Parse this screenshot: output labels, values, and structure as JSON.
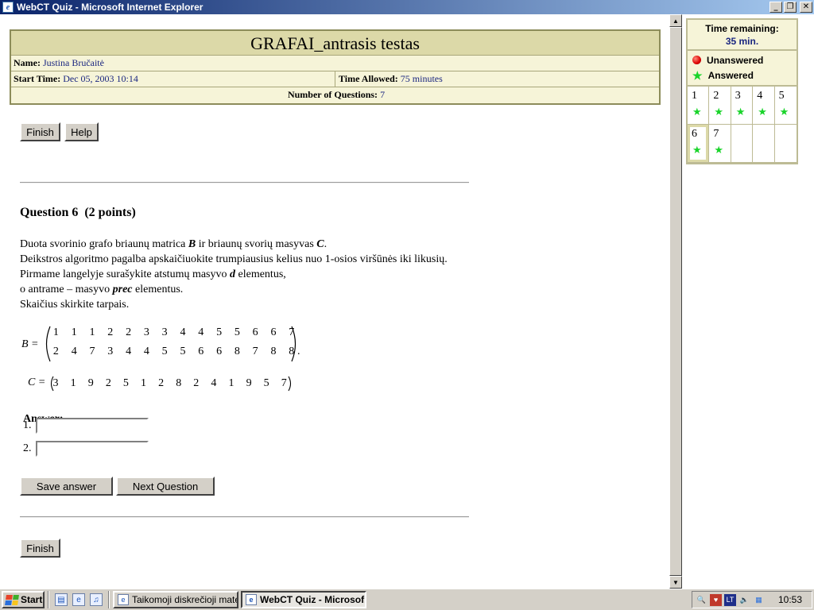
{
  "window": {
    "title": "WebCT Quiz - Microsoft Internet Explorer"
  },
  "quiz": {
    "title": "GRAFAI_antrasis testas",
    "name_label": "Name:",
    "name_value": "Justina Bručaitė",
    "start_label": "Start Time:",
    "start_value": "Dec 05, 2003 10:14",
    "allowed_label": "Time Allowed:",
    "allowed_value": "75 minutes",
    "count_label": "Number of Questions:",
    "count_value": "7"
  },
  "buttons": {
    "finish": "Finish",
    "help": "Help",
    "save_answer": "Save answer",
    "next_question": "Next Question"
  },
  "question": {
    "title": "Question 6  (2 points)",
    "lines": [
      [
        "Duota svorinio grafo briaunų matrica ",
        "B",
        " ir briaunų svorių masyvas ",
        "C",
        "."
      ],
      [
        "Deikstros algoritmo pagalba apskaičiuokite trumpiausius kelius nuo 1-osios viršūnės iki likusių."
      ],
      [
        "Pirmame langelyje surašykite atstumų masyvo ",
        "d",
        " elementus,"
      ],
      [
        "o antrame – masyvo ",
        "prec",
        " elementus."
      ],
      [
        "Skaičius skirkite tarpais."
      ]
    ],
    "matrix_B_name": "B =",
    "matrix_B_row1": [
      "1",
      "1",
      "1",
      "2",
      "2",
      "3",
      "3",
      "4",
      "4",
      "5",
      "5",
      "6",
      "6",
      "7"
    ],
    "matrix_B_row2": [
      "2",
      "4",
      "7",
      "3",
      "4",
      "4",
      "5",
      "5",
      "6",
      "6",
      "8",
      "7",
      "8",
      "8"
    ],
    "matrix_C_name": "C =",
    "matrix_C_row": [
      "3",
      "1",
      "9",
      "2",
      "5",
      "1",
      "2",
      "8",
      "2",
      "4",
      "1",
      "9",
      "5",
      "7"
    ],
    "answer_label": "Answer:",
    "answer_1_num": "1.",
    "answer_1_value": "",
    "answer_2_num": "2.",
    "answer_2_value": ""
  },
  "status_panel": {
    "time_label": "Time remaining:",
    "time_value": "35 min.",
    "unanswered_label": "Unanswered",
    "answered_label": "Answered",
    "questions": [
      {
        "num": "1",
        "status": "answered"
      },
      {
        "num": "2",
        "status": "answered"
      },
      {
        "num": "3",
        "status": "answered"
      },
      {
        "num": "4",
        "status": "answered"
      },
      {
        "num": "5",
        "status": "answered"
      },
      {
        "num": "6",
        "status": "answered",
        "current": true
      },
      {
        "num": "7",
        "status": "answered"
      }
    ]
  },
  "taskbar": {
    "start_label": "Start",
    "task1": "Taikomoji diskrečioji mate...",
    "task2": "WebCT Quiz - Microsof...",
    "clock": "10:53"
  },
  "colors": {
    "header_bg": "#dcd9a8",
    "value_text": "#1a2680",
    "answered_star": "#19d42a",
    "titlebar_start": "#0a246a",
    "titlebar_end": "#a6caf0"
  }
}
